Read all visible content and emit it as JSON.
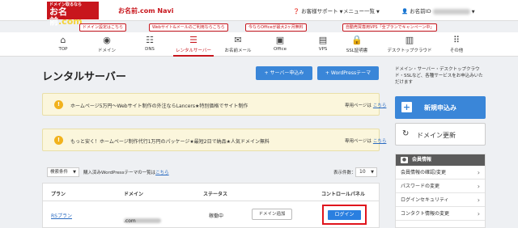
{
  "header": {
    "logo_small": "ドメイン取るなら",
    "logo_main_prefix": "お名前",
    "logo_main_suffix": ".com",
    "brand": "お名前.com Navi",
    "support": "お客様サポート",
    "menu": "メニュー一覧",
    "user_id_label": "お名前ID"
  },
  "promos": [
    "ドメイン設定はこちら",
    "Webサイト&メールのご利用ならこちら",
    "今ならOfficeが最大2ヶ月無料",
    "自動売買専用VPS「全プランでキャンペーン中」"
  ],
  "nav": [
    {
      "label": "TOP",
      "icon": "home-icon"
    },
    {
      "label": "ドメイン",
      "icon": "globe-icon"
    },
    {
      "label": "DNS",
      "icon": "dns-icon"
    },
    {
      "label": "レンタルサーバー",
      "icon": "server-icon"
    },
    {
      "label": "お名前メール",
      "icon": "mail-icon"
    },
    {
      "label": "Office",
      "icon": "office-icon"
    },
    {
      "label": "VPS",
      "icon": "vps-icon"
    },
    {
      "label": "SSL証明書",
      "icon": "ssl-icon"
    },
    {
      "label": "デスクトップクラウド",
      "icon": "desktop-cloud-icon"
    },
    {
      "label": "その他",
      "icon": "grid-icon"
    }
  ],
  "page": {
    "title": "レンタルサーバー",
    "apply_server": "+ サーバー申込み",
    "apply_wordpress": "+ WordPressテーマ",
    "side_copy": "ドメイン・サーバー・デスクトップクラウド・SSLなど、各種サービスをお申込みいただけます"
  },
  "notices": [
    {
      "text": "ホームページ5万円〜Webサイト制作の外注ならLancers★特別価格でサイト制作",
      "dedicated": "専用ページは",
      "link": "こちら"
    },
    {
      "text": "もっと安く！ホームページ制作代行1万円のパッケージ★最短2日で納品★人気ドメイン無料",
      "dedicated": "専用ページは",
      "link": "こちら"
    }
  ],
  "sidebar": {
    "apply": "新規申込み",
    "renew": "ドメイン更新",
    "member_header": "会員情報",
    "member_items": [
      "会員情報の確認/変更",
      "パスワードの変更",
      "ログインセキュリティ",
      "コンタクト情報の変更"
    ]
  },
  "filter": {
    "select_label": "検索条件",
    "text": "購入済みWordPressテーマの一覧は",
    "link": "こちら",
    "count_label": "表示件数：",
    "count_value": "10"
  },
  "table": {
    "headers": [
      "プラン",
      "ドメイン",
      "ステータス",
      "コントロールパネル"
    ],
    "row": {
      "plan": "RSプラン",
      "domain_suffix": ".com",
      "status": "稼働中",
      "add_domain": "ドメイン追加",
      "login": "ログイン"
    }
  },
  "colors": {
    "brand_red": "#c8161d",
    "accent_blue": "#3a86d8",
    "notice_bg": "#fbf6dc"
  }
}
